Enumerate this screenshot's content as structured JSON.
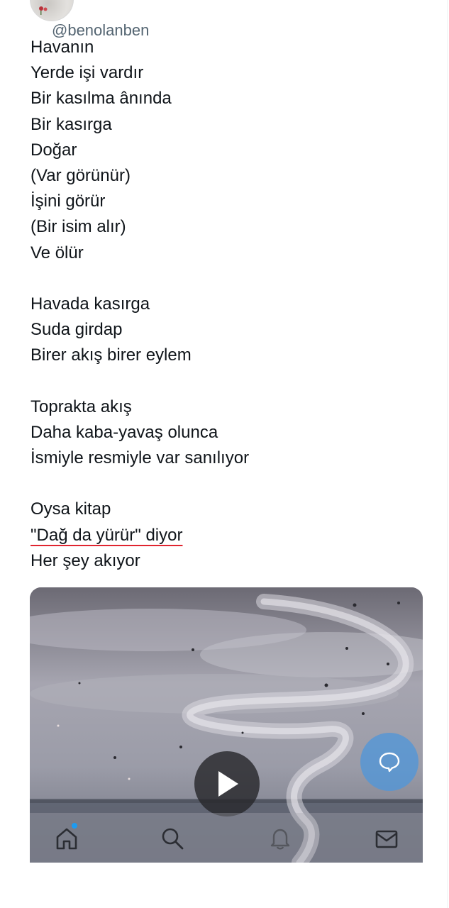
{
  "author": {
    "handle": "@benolanben"
  },
  "poem": {
    "lines": [
      "Havanın",
      "Yerde işi vardır",
      "Bir kasılma ânında",
      "Bir kasırga",
      "Doğar",
      "(Var görünür)",
      "İşini görür",
      "(Bir isim alır)",
      "Ve ölür",
      "",
      "Havada kasırga",
      "Suda girdap",
      "Birer akış birer eylem",
      "",
      "Toprakta akış",
      "Daha kaba-yavaş olunca",
      "İsmiyle resmiyle var sanılıyor",
      "",
      "Oysa kitap",
      "\"Dağ da yürür\" diyor",
      "Her şey akıyor"
    ]
  },
  "media": {
    "type": "video",
    "play_icon": "play-icon"
  },
  "compose": {
    "icon": "chat-bubble-icon",
    "color": "#5496d6"
  },
  "bottom_nav": {
    "items": [
      {
        "name": "home",
        "icon": "home-icon",
        "has_notification": true
      },
      {
        "name": "search",
        "icon": "search-icon",
        "has_notification": false
      },
      {
        "name": "notifications",
        "icon": "bell-icon",
        "has_notification": false
      },
      {
        "name": "messages",
        "icon": "mail-icon",
        "has_notification": false
      }
    ]
  },
  "colors": {
    "text": "#0f1419",
    "handle": "#536471",
    "accent": "#1d9bf0",
    "spellcheck_underline": "#e0242f"
  }
}
